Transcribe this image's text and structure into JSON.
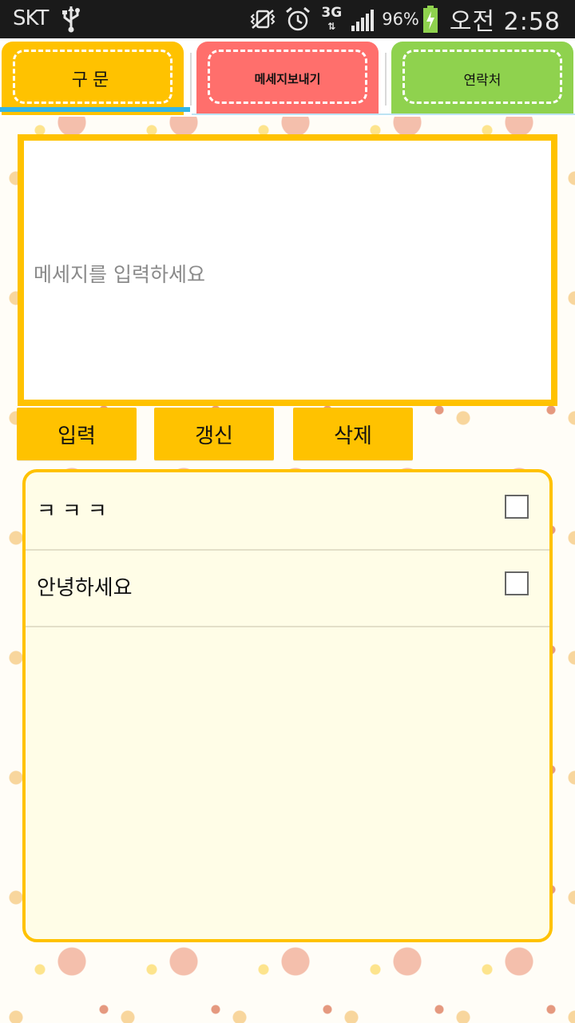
{
  "status_bar": {
    "carrier": "SKT",
    "network_type": "3G",
    "battery_percent": "96%",
    "time": "오전 2:58",
    "icons": [
      "usb-icon",
      "vibrate-off-icon",
      "alarm-icon",
      "network-3g-icon",
      "signal-icon",
      "battery-charging-icon"
    ]
  },
  "tabs": [
    {
      "label": "구문",
      "color": "#ffc200",
      "selected": true
    },
    {
      "label": "메세지보내기",
      "color": "#ff6f6c",
      "selected": false
    },
    {
      "label": "연락처",
      "color": "#8fd24e",
      "selected": false
    }
  ],
  "colors": {
    "accent": "#ffc200",
    "selected_underline": "#33b5e5",
    "panel_bg": "#fffde7"
  },
  "message": {
    "value": "",
    "placeholder": "메세지를 입력하세요"
  },
  "buttons": {
    "input": "입력",
    "refresh": "갱신",
    "delete": "삭제"
  },
  "list": {
    "items": [
      {
        "label": "ㅋㅋㅋ",
        "checked": false
      },
      {
        "label": "안녕하세요",
        "checked": false
      }
    ]
  }
}
